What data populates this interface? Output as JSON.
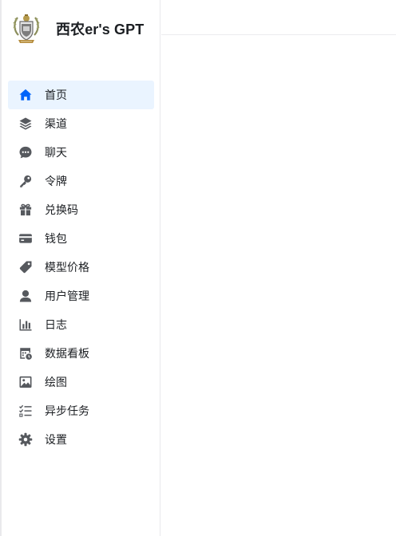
{
  "brand": {
    "title": "西农er's GPT",
    "logo_icon": "university-crest-logo"
  },
  "sidebar": {
    "items": [
      {
        "label": "首页",
        "icon": "home-icon",
        "active": true
      },
      {
        "label": "渠道",
        "icon": "layers-icon",
        "active": false
      },
      {
        "label": "聊天",
        "icon": "chat-bubble-icon",
        "active": false
      },
      {
        "label": "令牌",
        "icon": "key-icon",
        "active": false
      },
      {
        "label": "兑换码",
        "icon": "gift-icon",
        "active": false
      },
      {
        "label": "钱包",
        "icon": "credit-card-icon",
        "active": false
      },
      {
        "label": "模型价格",
        "icon": "price-tag-icon",
        "active": false
      },
      {
        "label": "用户管理",
        "icon": "user-icon",
        "active": false
      },
      {
        "label": "日志",
        "icon": "bar-chart-icon",
        "active": false
      },
      {
        "label": "数据看板",
        "icon": "dashboard-calendar-icon",
        "active": false
      },
      {
        "label": "绘图",
        "icon": "image-icon",
        "active": false
      },
      {
        "label": "异步任务",
        "icon": "checklist-icon",
        "active": false
      },
      {
        "label": "设置",
        "icon": "gear-icon",
        "active": false
      }
    ]
  },
  "colors": {
    "accent": "#0064fa",
    "active_bg": "#eaf4ff",
    "icon_gray": "#56595e",
    "text": "#1c1f23",
    "border": "#e8e8ec"
  }
}
